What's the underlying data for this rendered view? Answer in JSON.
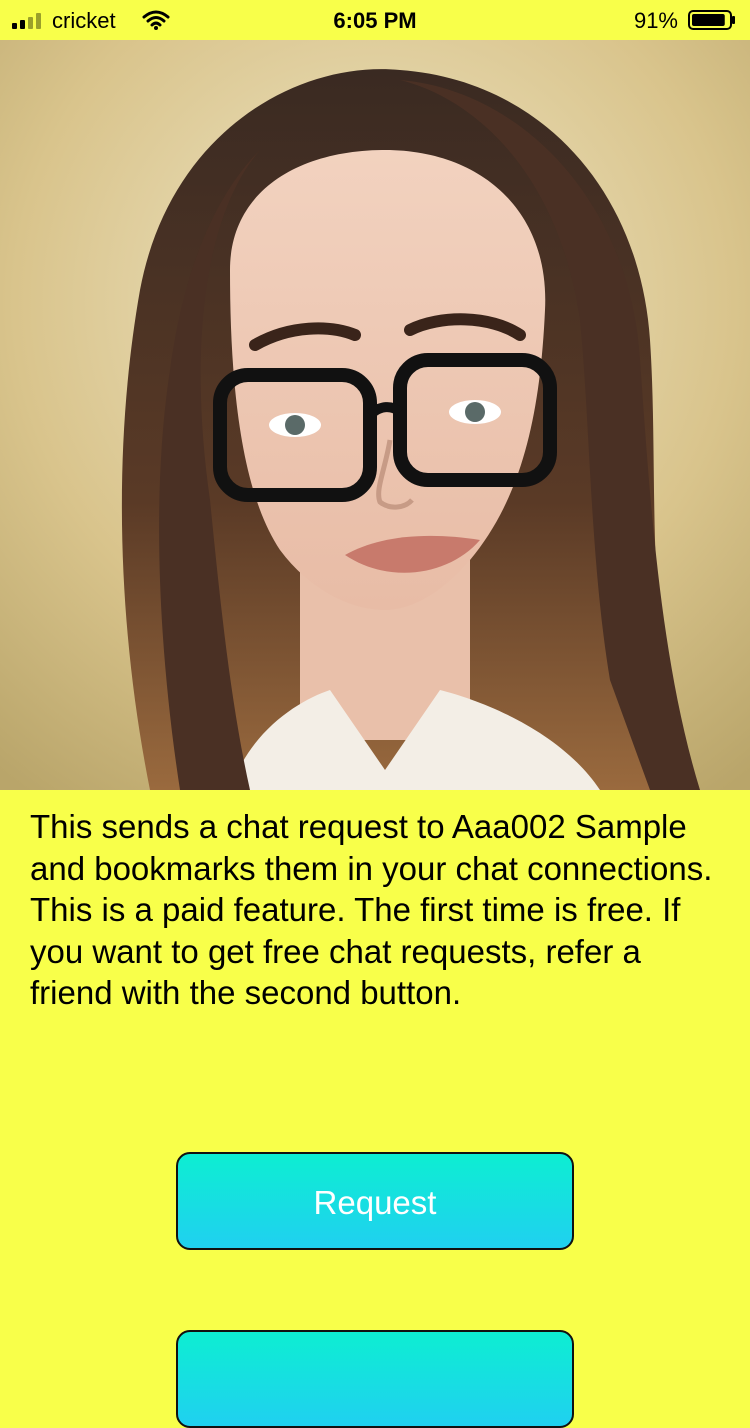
{
  "status_bar": {
    "carrier": "cricket",
    "time": "6:05 PM",
    "battery_percent": "91%",
    "battery_level": 0.91,
    "signal_bars_filled": 2,
    "signal_bars_total": 4
  },
  "photo": {
    "icon": "profile-photo"
  },
  "description": "This sends a chat request to Aaa002 Sample and bookmarks them in your chat connections.  This is a paid feature.  The first time is free.  If you want to get free chat requests, refer a friend with the second button.",
  "buttons": {
    "request_label": "Request",
    "second_label": ""
  },
  "colors": {
    "background": "#f8ff4a",
    "button_top": "#0deed2",
    "button_bottom": "#20d0f0"
  }
}
